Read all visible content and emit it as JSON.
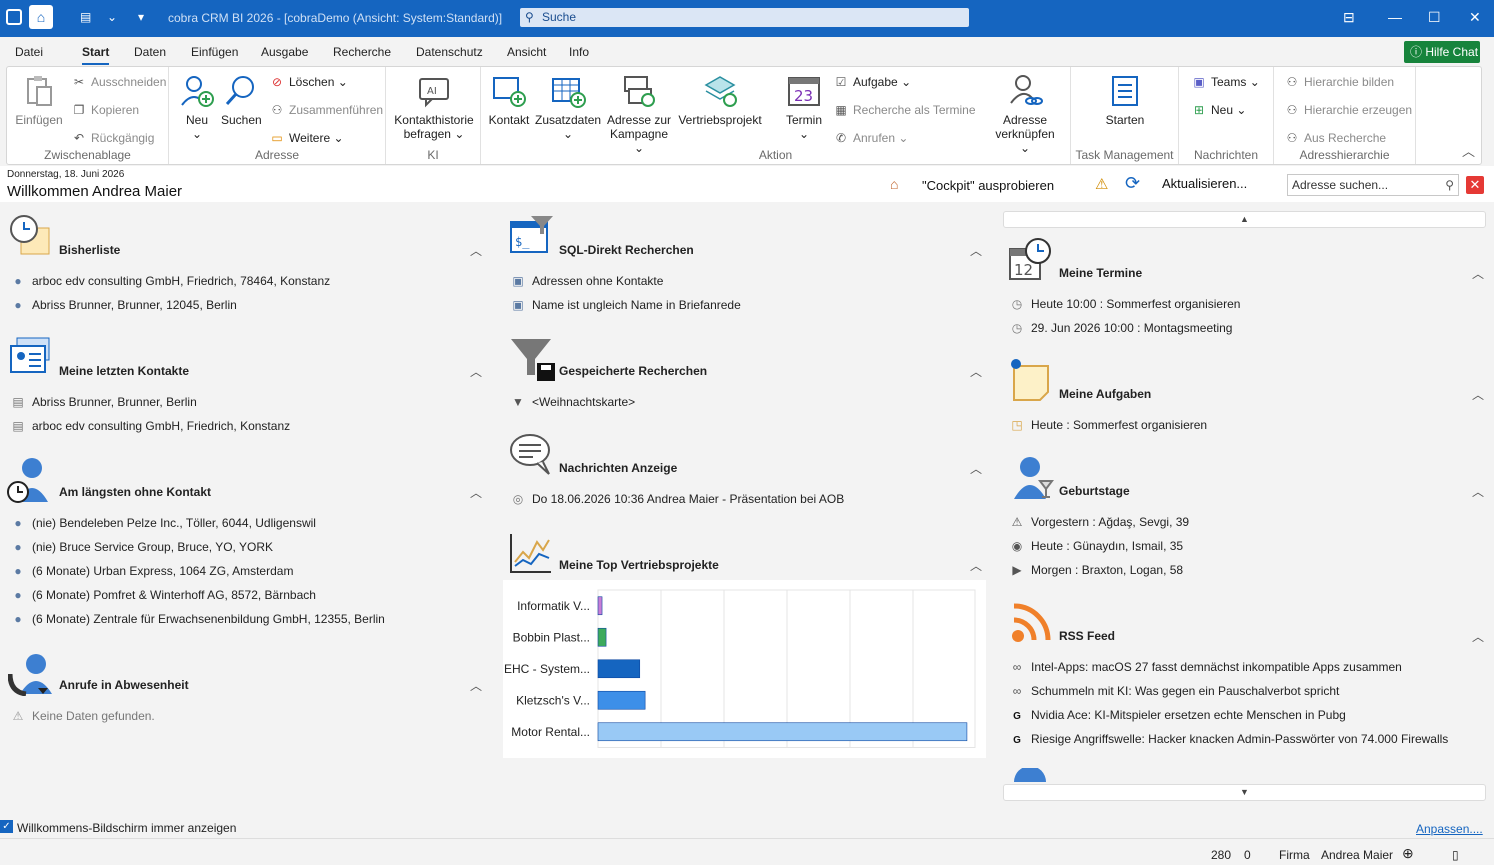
{
  "titlebar": {
    "title": "cobra CRM BI 2026 - [cobraDemo (Ansicht: System:Standard)]",
    "search": "Suche"
  },
  "menu": [
    "Datei",
    "Start",
    "Daten",
    "Einfügen",
    "Ausgabe",
    "Recherche",
    "Datenschutz",
    "Ansicht",
    "Info"
  ],
  "hilfe": "Hilfe Chat",
  "ribbon": {
    "zwischenablage": {
      "label": "Zwischenablage",
      "einfuegen": "Einfügen",
      "ausschneiden": "Ausschneiden",
      "kopieren": "Kopieren",
      "rueckgaengig": "Rückgängig"
    },
    "adresse": {
      "label": "Adresse",
      "neu": "Neu",
      "suchen": "Suchen",
      "loeschen": "Löschen",
      "zusammenfuehren": "Zusammenführen",
      "weitere": "Weitere"
    },
    "ki": {
      "label": "KI",
      "kontakthistorie": "Kontakthistorie",
      "befragen": "befragen"
    },
    "aktion": {
      "label": "Aktion",
      "kontakt": "Kontakt",
      "zusatzdaten": "Zusatzdaten",
      "adresse_zur": "Adresse zur",
      "kampagne": "Kampagne",
      "vertriebsprojekt": "Vertriebsprojekt",
      "termin": "Termin",
      "aufgabe": "Aufgabe",
      "recherche_termine": "Recherche als Termine",
      "anrufen": "Anrufen",
      "adresse": "Adresse",
      "verknuepfen": "verknüpfen"
    },
    "task": {
      "label": "Task Management",
      "starten": "Starten"
    },
    "nachrichten": {
      "label": "Nachrichten",
      "teams": "Teams",
      "neu": "Neu"
    },
    "hierarchie": {
      "label": "Adresshierarchie",
      "bilden": "Hierarchie bilden",
      "erzeugen": "Hierarchie erzeugen",
      "aus_recherche": "Aus Recherche"
    }
  },
  "info": {
    "date": "Donnerstag, 18. Juni 2026",
    "welcome": "Willkommen Andrea Maier",
    "cockpit": "\"Cockpit\" ausprobieren",
    "aktualisieren": "Aktualisieren...",
    "adr_search": "Adresse suchen..."
  },
  "bisherliste": {
    "title": "Bisherliste",
    "items": [
      "arboc edv consulting GmbH, Friedrich, 78464, Konstanz",
      "Abriss Brunner, Brunner, 12045, Berlin"
    ]
  },
  "letzte": {
    "title": "Meine letzten Kontakte",
    "items": [
      "Abriss Brunner, Brunner, Berlin",
      "arboc edv consulting GmbH, Friedrich, Konstanz"
    ]
  },
  "laengste": {
    "title": "Am längsten ohne Kontakt",
    "items": [
      "(nie) Bendeleben Pelze Inc., Töller, 6044, Udligenswil",
      "(nie) Bruce Service Group, Bruce, YO, YORK",
      "(6 Monate) Urban Express, 1064 ZG, Amsterdam",
      "(6 Monate) Pomfret & Winterhoff AG, 8572, Bärnbach",
      "(6 Monate) Zentrale für Erwachsenenbildung GmbH, 12355, Berlin"
    ]
  },
  "anrufe": {
    "title": "Anrufe in Abwesenheit",
    "empty": "Keine Daten gefunden."
  },
  "sql": {
    "title": "SQL-Direkt Recherchen",
    "items": [
      "Adressen ohne Kontakte",
      "Name ist ungleich Name in Briefanrede"
    ]
  },
  "gespeichert": {
    "title": "Gespeicherte Recherchen",
    "items": [
      "<Weihnachtskarte>"
    ]
  },
  "nachrichten": {
    "title": "Nachrichten Anzeige",
    "items": [
      "Do 18.06.2026 10:36 Andrea Maier - Präsentation bei AOB"
    ]
  },
  "vertrieb": {
    "title": "Meine Top Vertriebsprojekte"
  },
  "termine": {
    "title": "Meine Termine",
    "items": [
      "Heute 10:00 : Sommerfest organisieren",
      "29. Jun 2026 10:00 : Montagsmeeting"
    ]
  },
  "aufgaben": {
    "title": "Meine Aufgaben",
    "items": [
      "Heute : Sommerfest organisieren"
    ]
  },
  "geburtstage": {
    "title": "Geburtstage",
    "items": [
      "Vorgestern : Ağdaş, Sevgi, 39",
      "Heute : Günaydın, Ismail, 35",
      "Morgen : Braxton, Logan, 58"
    ]
  },
  "rss": {
    "title": "RSS Feed",
    "items": [
      "Intel-Apps: macOS 27 fasst demnächst inkompatible Apps zusammen",
      "Schummeln mit KI: Was gegen ein Pauschalverbot spricht",
      "Nvidia Ace: KI-Mitspieler ersetzen echte Menschen in Pubg",
      "Riesige Angriffswelle: Hacker knacken Admin-Passwörter von 74.000 Firewalls"
    ]
  },
  "chart_data": {
    "type": "bar",
    "orientation": "horizontal",
    "categories": [
      "Informatik V...",
      "Bobbin Plast...",
      "EHC - System...",
      "Kletzsch's V...",
      "Motor Rental..."
    ],
    "values": [
      1.5,
      3,
      15.5,
      17.5,
      137
    ],
    "xlim": [
      0,
      140
    ],
    "colors": [
      "#c77dd6",
      "#3daa5c",
      "#1565c0",
      "#3d8fe8",
      "#99c9f5"
    ]
  },
  "footer": {
    "show_always": "Willkommens-Bildschirm immer anzeigen",
    "anpassen": "Anpassen....",
    "count1": "280",
    "count2": "0",
    "firma": "Firma",
    "user": "Andrea Maier"
  }
}
